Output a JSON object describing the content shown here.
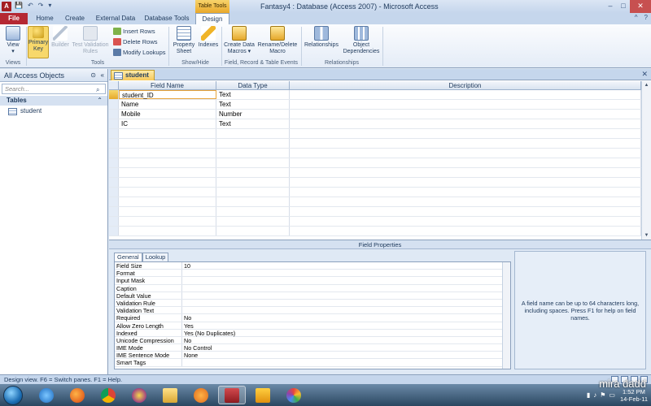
{
  "window": {
    "title": "Fantasy4 : Database (Access 2007)  -  Microsoft Access",
    "app_icon_letter": "A",
    "context_tab_header": "Table Tools",
    "controls": {
      "minimize": "–",
      "maximize": "□",
      "close": "✕"
    }
  },
  "ribbon_tabs": [
    "File",
    "Home",
    "Create",
    "External Data",
    "Database Tools",
    "Design"
  ],
  "ribbon": {
    "view": "View",
    "primary_key": "Primary\nKey",
    "builder": "Builder",
    "test_validation": "Test Validation\nRules",
    "insert_rows": "Insert Rows",
    "delete_rows": "Delete Rows",
    "modify_lookups": "Modify Lookups",
    "property_sheet": "Property\nSheet",
    "indexes": "Indexes",
    "create_data_macros": "Create Data\nMacros ▾",
    "rename_delete_macro": "Rename/Delete\nMacro",
    "relationships": "Relationships",
    "object_dependencies": "Object\nDependencies",
    "groups": {
      "views": "Views",
      "tools": "Tools",
      "show_hide": "Show/Hide",
      "field_record": "Field, Record & Table Events",
      "relationships": "Relationships"
    }
  },
  "nav": {
    "title": "All Access Objects",
    "search_placeholder": "Search...",
    "section": "Tables",
    "items": [
      "student"
    ]
  },
  "doc": {
    "tab": "student",
    "columns": [
      "Field Name",
      "Data Type",
      "Description"
    ],
    "rows": [
      {
        "field": "student_ID",
        "type": "Text"
      },
      {
        "field": "Name",
        "type": "Text"
      },
      {
        "field": "Mobile",
        "type": "Number"
      },
      {
        "field": "IC",
        "type": "Text"
      }
    ]
  },
  "field_properties": {
    "title": "Field Properties",
    "tabs": [
      "General",
      "Lookup"
    ],
    "props": [
      {
        "k": "Field Size",
        "v": "10"
      },
      {
        "k": "Format",
        "v": ""
      },
      {
        "k": "Input Mask",
        "v": ""
      },
      {
        "k": "Caption",
        "v": ""
      },
      {
        "k": "Default Value",
        "v": ""
      },
      {
        "k": "Validation Rule",
        "v": ""
      },
      {
        "k": "Validation Text",
        "v": ""
      },
      {
        "k": "Required",
        "v": "No"
      },
      {
        "k": "Allow Zero Length",
        "v": "Yes"
      },
      {
        "k": "Indexed",
        "v": "Yes (No Duplicates)"
      },
      {
        "k": "Unicode Compression",
        "v": "No"
      },
      {
        "k": "IME Mode",
        "v": "No Control"
      },
      {
        "k": "IME Sentence Mode",
        "v": "None"
      },
      {
        "k": "Smart Tags",
        "v": ""
      }
    ],
    "help": "A field name can be up to 64 characters long, including spaces. Press F1 for help on field names."
  },
  "status": "Design view.  F6 = Switch panes.  F1 = Help.",
  "taskbar": {
    "time": "1:52 PM",
    "date": "14-Feb-11",
    "user": "mira dadd"
  },
  "colors": {
    "file_tab": "#b52833",
    "context_tab": "#e9a82b",
    "active_tab": "#f7c95c"
  }
}
